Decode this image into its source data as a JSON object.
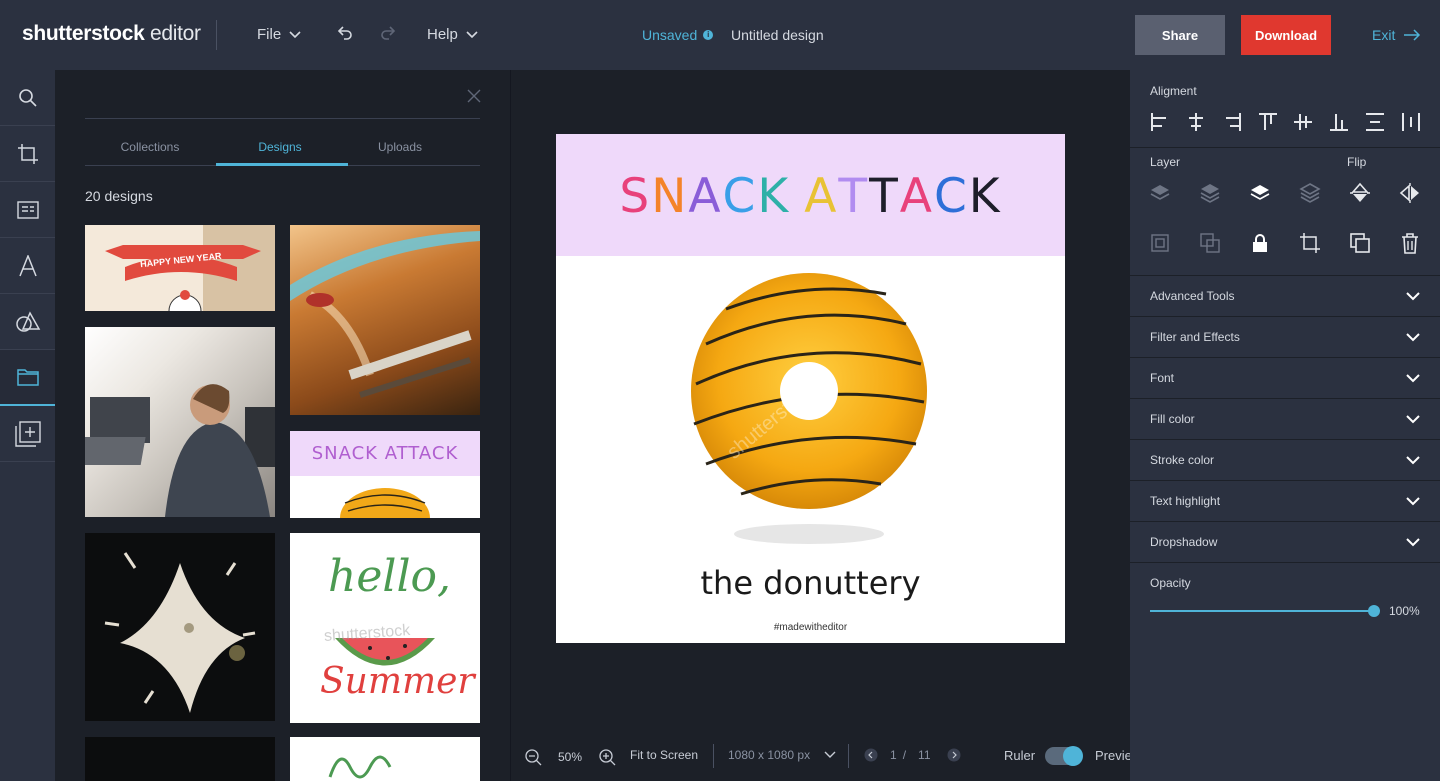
{
  "app": {
    "brand": "shutterstck",
    "brand_o": "o",
    "brand_suffix": "editor"
  },
  "menu": {
    "file": "File",
    "help": "Help"
  },
  "status": {
    "unsaved": "Unsaved",
    "title": "Untitled design"
  },
  "actions": {
    "share": "Share",
    "download": "Download",
    "exit": "Exit"
  },
  "rail": [
    "search-icon",
    "crop-icon",
    "text-box-icon",
    "text-icon",
    "shapes-icon",
    "folder-icon",
    "add-page-icon"
  ],
  "panel": {
    "tabs": [
      "Collections",
      "Designs",
      "Uploads"
    ],
    "active_tab": "Designs",
    "count": "20 designs",
    "thumbs": {
      "happy": "HAPPY NEW YEAR",
      "snack": "SNACK ATTACK",
      "hello": "hello,",
      "summer": "Summer",
      "watermark": "shutterstock"
    }
  },
  "canvas": {
    "headline": [
      "S",
      "N",
      "A",
      "C",
      "K",
      " ",
      "A",
      "T",
      "T",
      "A",
      "C",
      "K"
    ],
    "headline_colors": [
      "#e8417b",
      "#f4832a",
      "#8a5dd8",
      "#3a9fe8",
      "#2eb0a8",
      "#000000",
      "#e8c235",
      "#b18cf0",
      "#b18cf0",
      "#1e1e2a",
      "#e8417b",
      "#2e6fd8"
    ],
    "subtitle": "the donuttery",
    "hashtag": "#madewitheditor",
    "watermark": "shutterstock"
  },
  "bottom": {
    "zoom": "50%",
    "fit": "Fit to Screen",
    "size": "1080 x 1080 px",
    "page": "1",
    "page_sep": "/",
    "pages": "11",
    "ruler": "Ruler",
    "preview": "Previe"
  },
  "properties": {
    "alignment": "Aligment",
    "layer": "Layer",
    "flip": "Flip",
    "sections": [
      "Advanced Tools",
      "Filter and Effects",
      "Font",
      "Fill color",
      "Stroke color",
      "Text highlight",
      "Dropshadow"
    ],
    "opacity": "Opacity",
    "opacity_value": "100%"
  },
  "colors": {
    "accent": "#4fb4d8",
    "download": "#e0382f",
    "share": "#5a6070",
    "panel": "#2b3140"
  }
}
